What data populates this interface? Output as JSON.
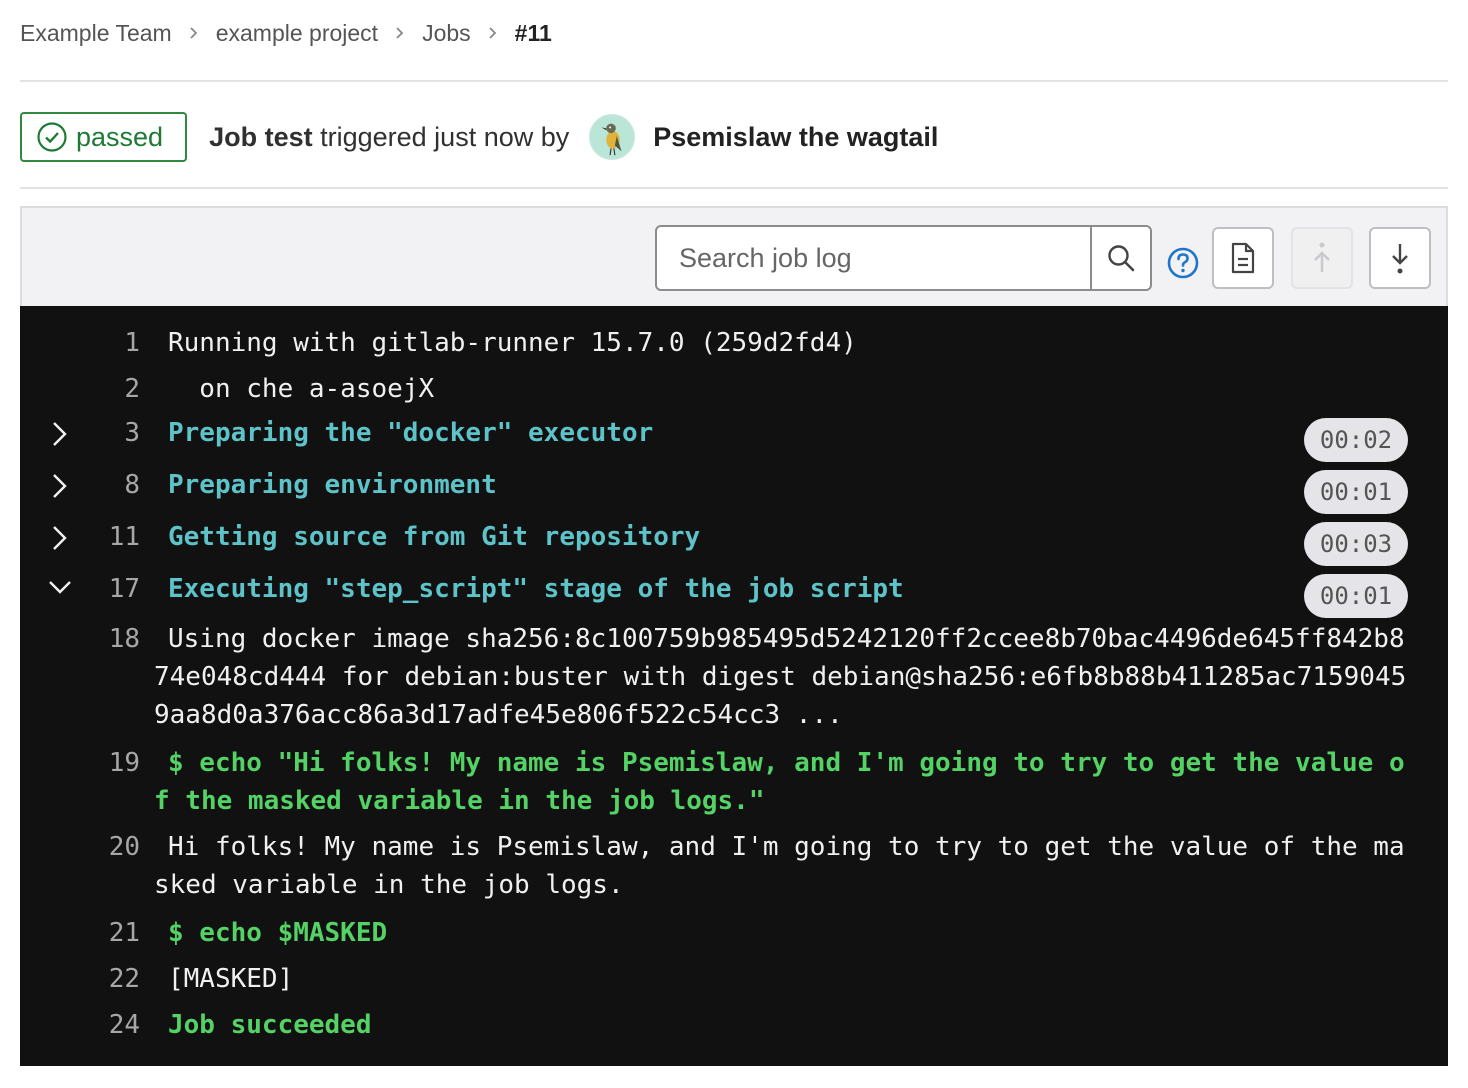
{
  "breadcrumb": {
    "items": [
      "Example Team",
      "example project",
      "Jobs"
    ],
    "current": "#11"
  },
  "header": {
    "status": "passed",
    "job_prefix": "Job ",
    "job_name": "test",
    "triggered_text": " triggered just now by",
    "user_name": "Psemislaw the wagtail"
  },
  "toolbar": {
    "search_placeholder": "Search job log"
  },
  "log": {
    "lines": [
      {
        "num": "1",
        "text": "Running with gitlab-runner 15.7.0 (259d2fd4)"
      },
      {
        "num": "2",
        "text": "  on che a-asoejX"
      },
      {
        "num": "3",
        "text": "Preparing the \"docker\" executor",
        "duration": "00:02"
      },
      {
        "num": "8",
        "text": "Preparing environment",
        "duration": "00:01"
      },
      {
        "num": "11",
        "text": "Getting source from Git repository",
        "duration": "00:03"
      },
      {
        "num": "17",
        "text": "Executing \"step_script\" stage of the job script",
        "duration": "00:01"
      },
      {
        "num": "18",
        "text": "Using docker image sha256:8c100759b985495d5242120ff2ccee8b70bac4496de645ff842b874e048cd444 for debian:buster with digest debian@sha256:e6fb8b88b411285ac71590459aa8d0a376acc86a3d17adfe45e806f522c54cc3 ..."
      },
      {
        "num": "19",
        "text": "$ echo \"Hi folks! My name is Psemislaw, and I'm going to try to get the value of the masked variable in the job logs.\""
      },
      {
        "num": "20",
        "text": "Hi folks! My name is Psemislaw, and I'm going to try to get the value of the masked variable in the job logs."
      },
      {
        "num": "21",
        "text": "$ echo $MASKED"
      },
      {
        "num": "22",
        "text": "[MASKED]"
      },
      {
        "num": "24",
        "text": "Job succeeded"
      }
    ]
  },
  "colors": {
    "passed": "#1f7a36",
    "section": "#5ec3c9",
    "command": "#54d265",
    "log_bg": "#111111"
  }
}
